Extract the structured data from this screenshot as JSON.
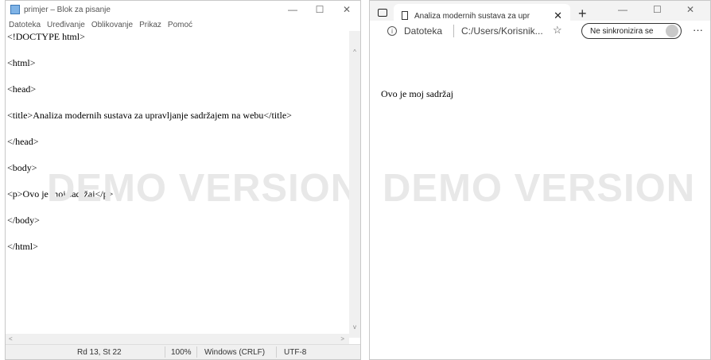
{
  "notepad": {
    "title": "primjer – Blok za pisanje",
    "controls": {
      "minimize": "—",
      "maximize": "☐",
      "close": "✕"
    },
    "menu": [
      "Datoteka",
      "Uređivanje",
      "Oblikovanje",
      "Prikaz",
      "Pomoć"
    ],
    "lines": [
      "<!DOCTYPE html>",
      "<html>",
      "<head>",
      "<title>Analiza modernih sustava za upravljanje sadržajem na webu</title>",
      "</head>",
      "<body>",
      "<p>Ovo je moj sadržaj</p>",
      "</body>",
      "</html>"
    ],
    "status": {
      "position": "Rd 13, St 22",
      "zoom": "100%",
      "line_ending": "Windows (CRLF)",
      "encoding": "UTF-8"
    },
    "scroll": {
      "up": "^",
      "down": "v",
      "left": "<",
      "right": ">"
    }
  },
  "watermark": "DEMO VERSION",
  "edge": {
    "tab_title": "Analiza modernih sustava za upr",
    "tab_close": "✕",
    "new_tab": "+",
    "controls": {
      "minimize": "—",
      "maximize": "☐",
      "close": "✕"
    },
    "address": {
      "info": "i",
      "scheme_label": "Datoteka",
      "url": "C:/Users/Korisnik..."
    },
    "fav_icon": "☆",
    "sync_label": "Ne sinkronizira se",
    "more": "···",
    "content": "Ovo je moj sadržaj"
  }
}
